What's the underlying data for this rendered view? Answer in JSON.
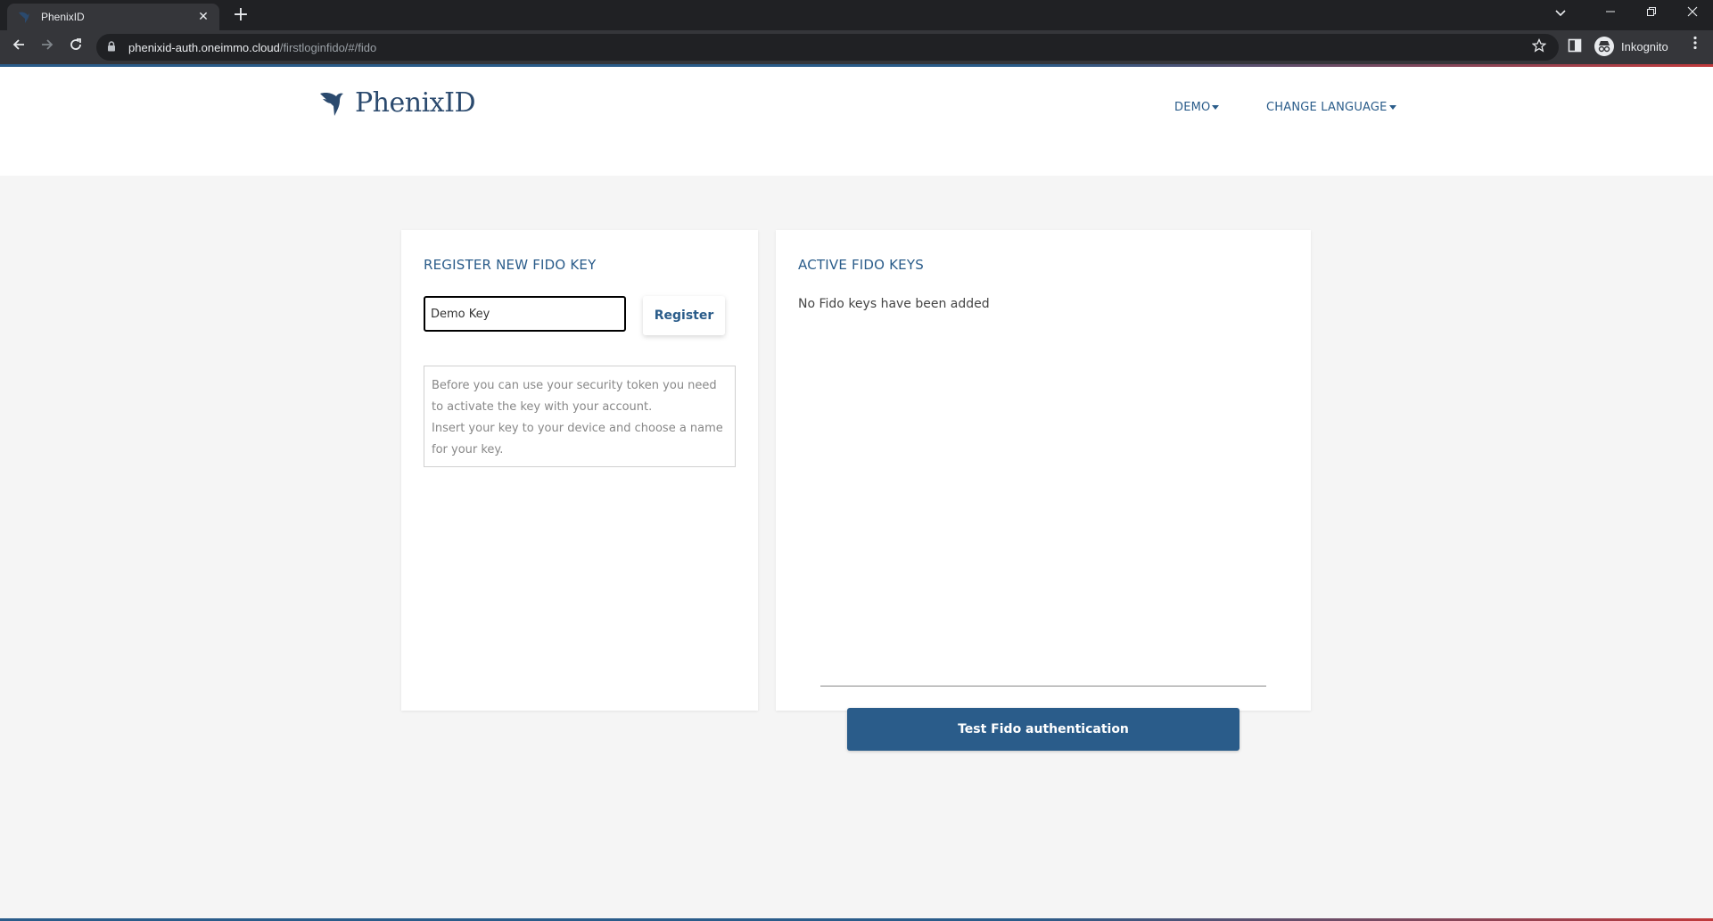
{
  "browser": {
    "tab_title": "PhenixID",
    "tab_close": "✕",
    "new_tab": "+",
    "url_host": "phenixid-auth.oneimmo.cloud",
    "url_path": "/firstloginfido/#/fido",
    "profile_label": "Inkognito"
  },
  "header": {
    "logo_text": "PhenixID",
    "menu_demo": "DEMO",
    "menu_language": "CHANGE LANGUAGE"
  },
  "register": {
    "title": "REGISTER NEW FIDO KEY",
    "key_name_value": "Demo Key",
    "register_label": "Register",
    "info_line1": "Before you can use your security token you need to activate the key with your account.",
    "info_line2": "Insert your key to your device and choose a name for your key."
  },
  "active_keys": {
    "title": "ACTIVE FIDO KEYS",
    "empty_message": "No Fido keys have been added",
    "test_label": "Test Fido authentication"
  },
  "colors": {
    "accent": "#2a5c8a",
    "logo": "#2b4a6e",
    "page_bg": "#f5f5f5"
  }
}
